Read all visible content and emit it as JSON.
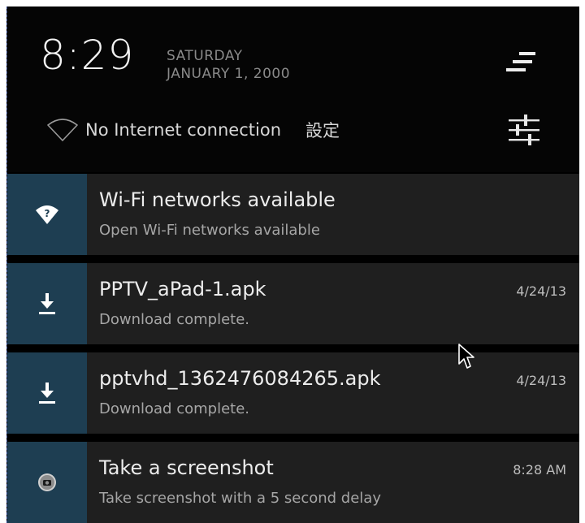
{
  "header": {
    "time": "8:29",
    "day": "SATURDAY",
    "date": "JANUARY 1, 2000",
    "network_status": "No Internet connection",
    "settings_label": "設定"
  },
  "notifications": [
    {
      "title": "Wi-Fi networks available",
      "subtitle": "Open Wi-Fi networks available",
      "time": "",
      "icon": "wifi-question-icon"
    },
    {
      "title": "PPTV_aPad-1.apk",
      "subtitle": "Download complete.",
      "time": "4/24/13",
      "icon": "download-icon"
    },
    {
      "title": "pptvhd_1362476084265.apk",
      "subtitle": "Download complete.",
      "time": "4/24/13",
      "icon": "download-icon"
    },
    {
      "title": "Take a screenshot",
      "subtitle": "Take screenshot with a 5 second delay",
      "time": "8:28 AM",
      "icon": "camera-icon"
    }
  ],
  "colors": {
    "background": "#000000",
    "notification_bg": "#1f1f1f",
    "icon_cell": "#1e3e52",
    "primary_text": "#ececec",
    "secondary_text": "#a6a6a6"
  }
}
